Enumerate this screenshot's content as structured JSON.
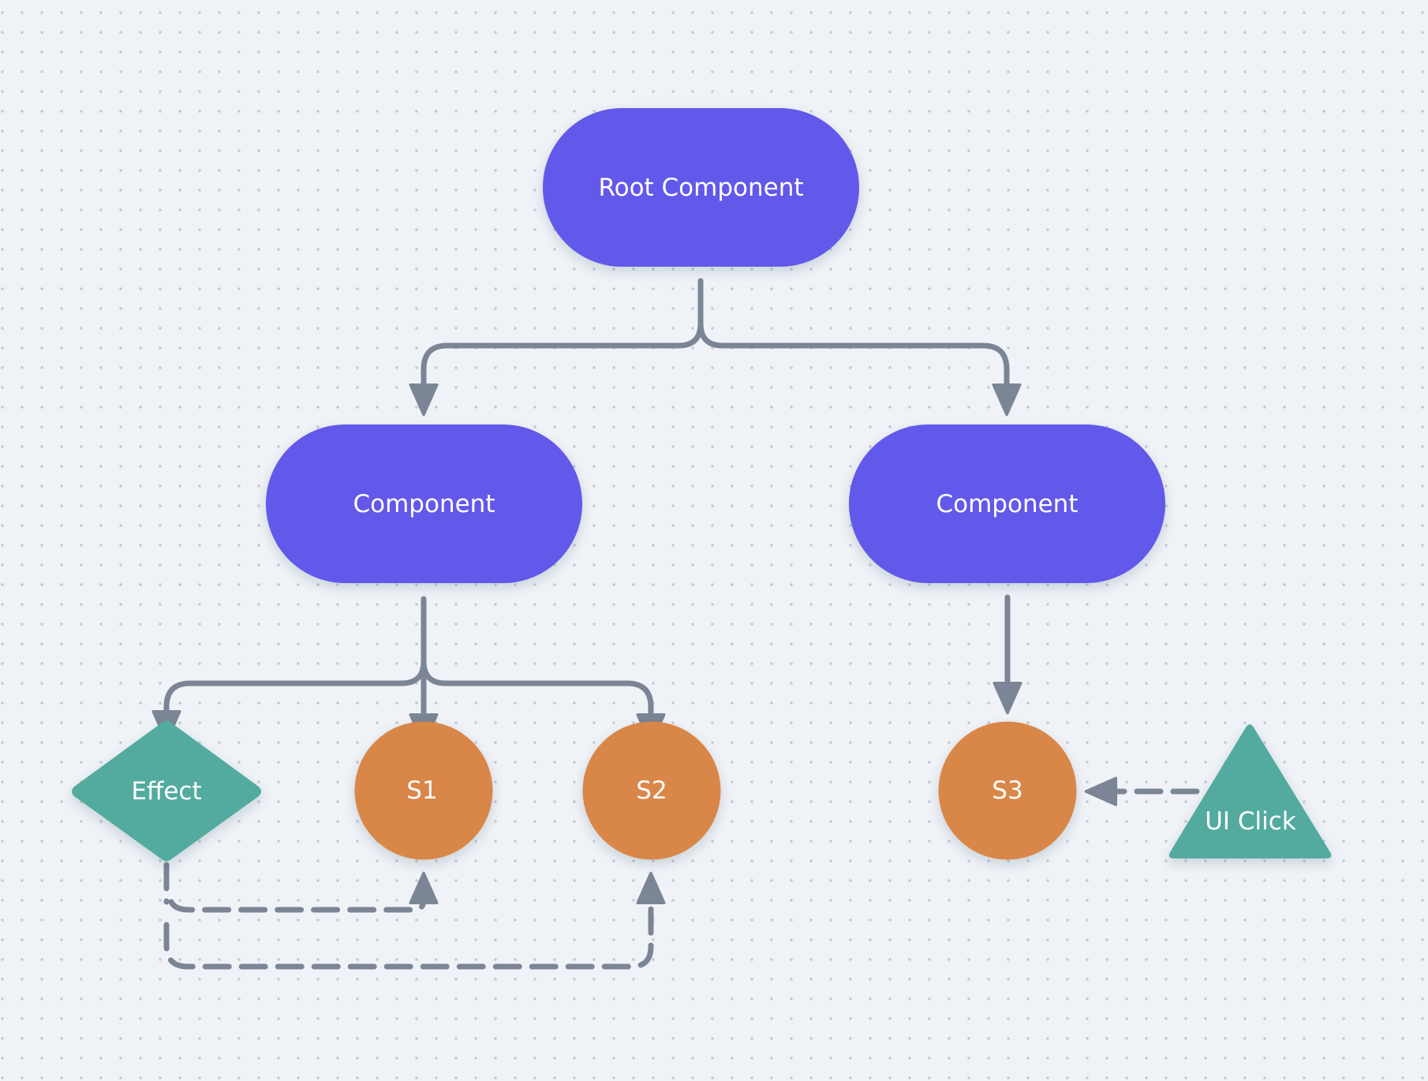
{
  "diagram": {
    "colors": {
      "component": "#6259ea",
      "state": "#d9874a",
      "event": "#52ab9f",
      "connector": "#7b8595",
      "background": "#eff3f7",
      "grid_dot": "#c3cad6",
      "label": "#ffffff"
    },
    "nodes": {
      "root": {
        "label": "Root Component",
        "shape": "pill"
      },
      "component_left": {
        "label": "Component",
        "shape": "pill"
      },
      "component_right": {
        "label": "Component",
        "shape": "pill"
      },
      "effect": {
        "label": "Effect",
        "shape": "diamond"
      },
      "s1": {
        "label": "S1",
        "shape": "circle"
      },
      "s2": {
        "label": "S2",
        "shape": "circle"
      },
      "s3": {
        "label": "S3",
        "shape": "circle"
      },
      "ui_click": {
        "label": "UI Click",
        "shape": "triangle"
      }
    },
    "edges": [
      {
        "from": "root",
        "to": "component_left",
        "style": "solid"
      },
      {
        "from": "root",
        "to": "component_right",
        "style": "solid"
      },
      {
        "from": "component_left",
        "to": "effect",
        "style": "solid"
      },
      {
        "from": "component_left",
        "to": "s1",
        "style": "solid"
      },
      {
        "from": "component_left",
        "to": "s2",
        "style": "solid"
      },
      {
        "from": "component_right",
        "to": "s3",
        "style": "solid"
      },
      {
        "from": "effect",
        "to": "s1",
        "style": "dashed"
      },
      {
        "from": "effect",
        "to": "s2",
        "style": "dashed"
      },
      {
        "from": "ui_click",
        "to": "s3",
        "style": "dashed"
      }
    ]
  }
}
